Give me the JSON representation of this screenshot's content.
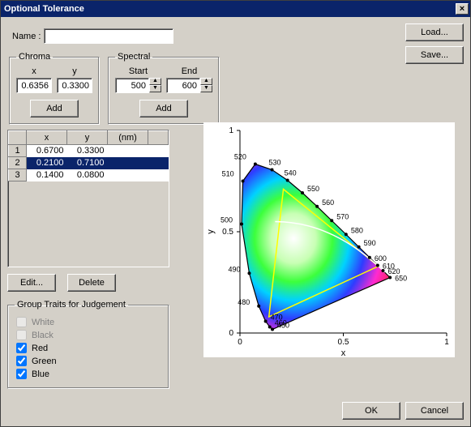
{
  "window": {
    "title": "Optional Tolerance"
  },
  "name": {
    "label": "Name :",
    "value": ""
  },
  "buttons": {
    "load": "Load...",
    "save": "Save...",
    "ok": "OK",
    "cancel": "Cancel",
    "edit": "Edit...",
    "delete": "Delete",
    "add": "Add"
  },
  "chroma": {
    "legend": "Chroma",
    "x_label": "x",
    "y_label": "y",
    "x_value": "0.6356",
    "y_value": "0.3300"
  },
  "spectral": {
    "legend": "Spectral",
    "start_label": "Start",
    "end_label": "End",
    "start_value": "500",
    "end_value": "600"
  },
  "table": {
    "headers": [
      "",
      "x",
      "y",
      "(nm)"
    ],
    "rows": [
      {
        "n": "1",
        "x": "0.6700",
        "y": "0.3300",
        "nm": "",
        "selected": false
      },
      {
        "n": "2",
        "x": "0.2100",
        "y": "0.7100",
        "nm": "",
        "selected": true
      },
      {
        "n": "3",
        "x": "0.1400",
        "y": "0.0800",
        "nm": "",
        "selected": false
      }
    ]
  },
  "traits": {
    "legend": "Group Traits for Judgement",
    "items": [
      {
        "label": "White",
        "checked": false,
        "disabled": true
      },
      {
        "label": "Black",
        "checked": false,
        "disabled": true
      },
      {
        "label": "Red",
        "checked": true,
        "disabled": false
      },
      {
        "label": "Green",
        "checked": true,
        "disabled": false
      },
      {
        "label": "Blue",
        "checked": true,
        "disabled": false
      }
    ]
  },
  "chart_data": {
    "type": "scatter",
    "title": "",
    "xlabel": "x",
    "ylabel": "y",
    "xlim": [
      0,
      1
    ],
    "ylim": [
      0,
      1
    ],
    "xticks": [
      0,
      0.5,
      1
    ],
    "yticks": [
      0,
      0.5,
      1
    ],
    "wavelength_labels": [
      450,
      460,
      470,
      480,
      490,
      500,
      510,
      520,
      530,
      540,
      550,
      560,
      570,
      580,
      590,
      600,
      610,
      620,
      650
    ],
    "triangle_vertices": [
      {
        "x": 0.67,
        "y": 0.33
      },
      {
        "x": 0.21,
        "y": 0.71
      },
      {
        "x": 0.14,
        "y": 0.08
      }
    ],
    "spectral_locus_approx": [
      {
        "nm": 450,
        "x": 0.157,
        "y": 0.018
      },
      {
        "nm": 460,
        "x": 0.144,
        "y": 0.03
      },
      {
        "nm": 470,
        "x": 0.124,
        "y": 0.058
      },
      {
        "nm": 480,
        "x": 0.091,
        "y": 0.133
      },
      {
        "nm": 490,
        "x": 0.045,
        "y": 0.295
      },
      {
        "nm": 500,
        "x": 0.008,
        "y": 0.538
      },
      {
        "nm": 510,
        "x": 0.014,
        "y": 0.75
      },
      {
        "nm": 520,
        "x": 0.074,
        "y": 0.834
      },
      {
        "nm": 530,
        "x": 0.155,
        "y": 0.806
      },
      {
        "nm": 540,
        "x": 0.23,
        "y": 0.754
      },
      {
        "nm": 550,
        "x": 0.302,
        "y": 0.692
      },
      {
        "nm": 560,
        "x": 0.373,
        "y": 0.625
      },
      {
        "nm": 570,
        "x": 0.444,
        "y": 0.555
      },
      {
        "nm": 580,
        "x": 0.513,
        "y": 0.487
      },
      {
        "nm": 590,
        "x": 0.575,
        "y": 0.425
      },
      {
        "nm": 600,
        "x": 0.627,
        "y": 0.373
      },
      {
        "nm": 610,
        "x": 0.666,
        "y": 0.334
      },
      {
        "nm": 620,
        "x": 0.692,
        "y": 0.308
      },
      {
        "nm": 650,
        "x": 0.726,
        "y": 0.274
      }
    ]
  }
}
